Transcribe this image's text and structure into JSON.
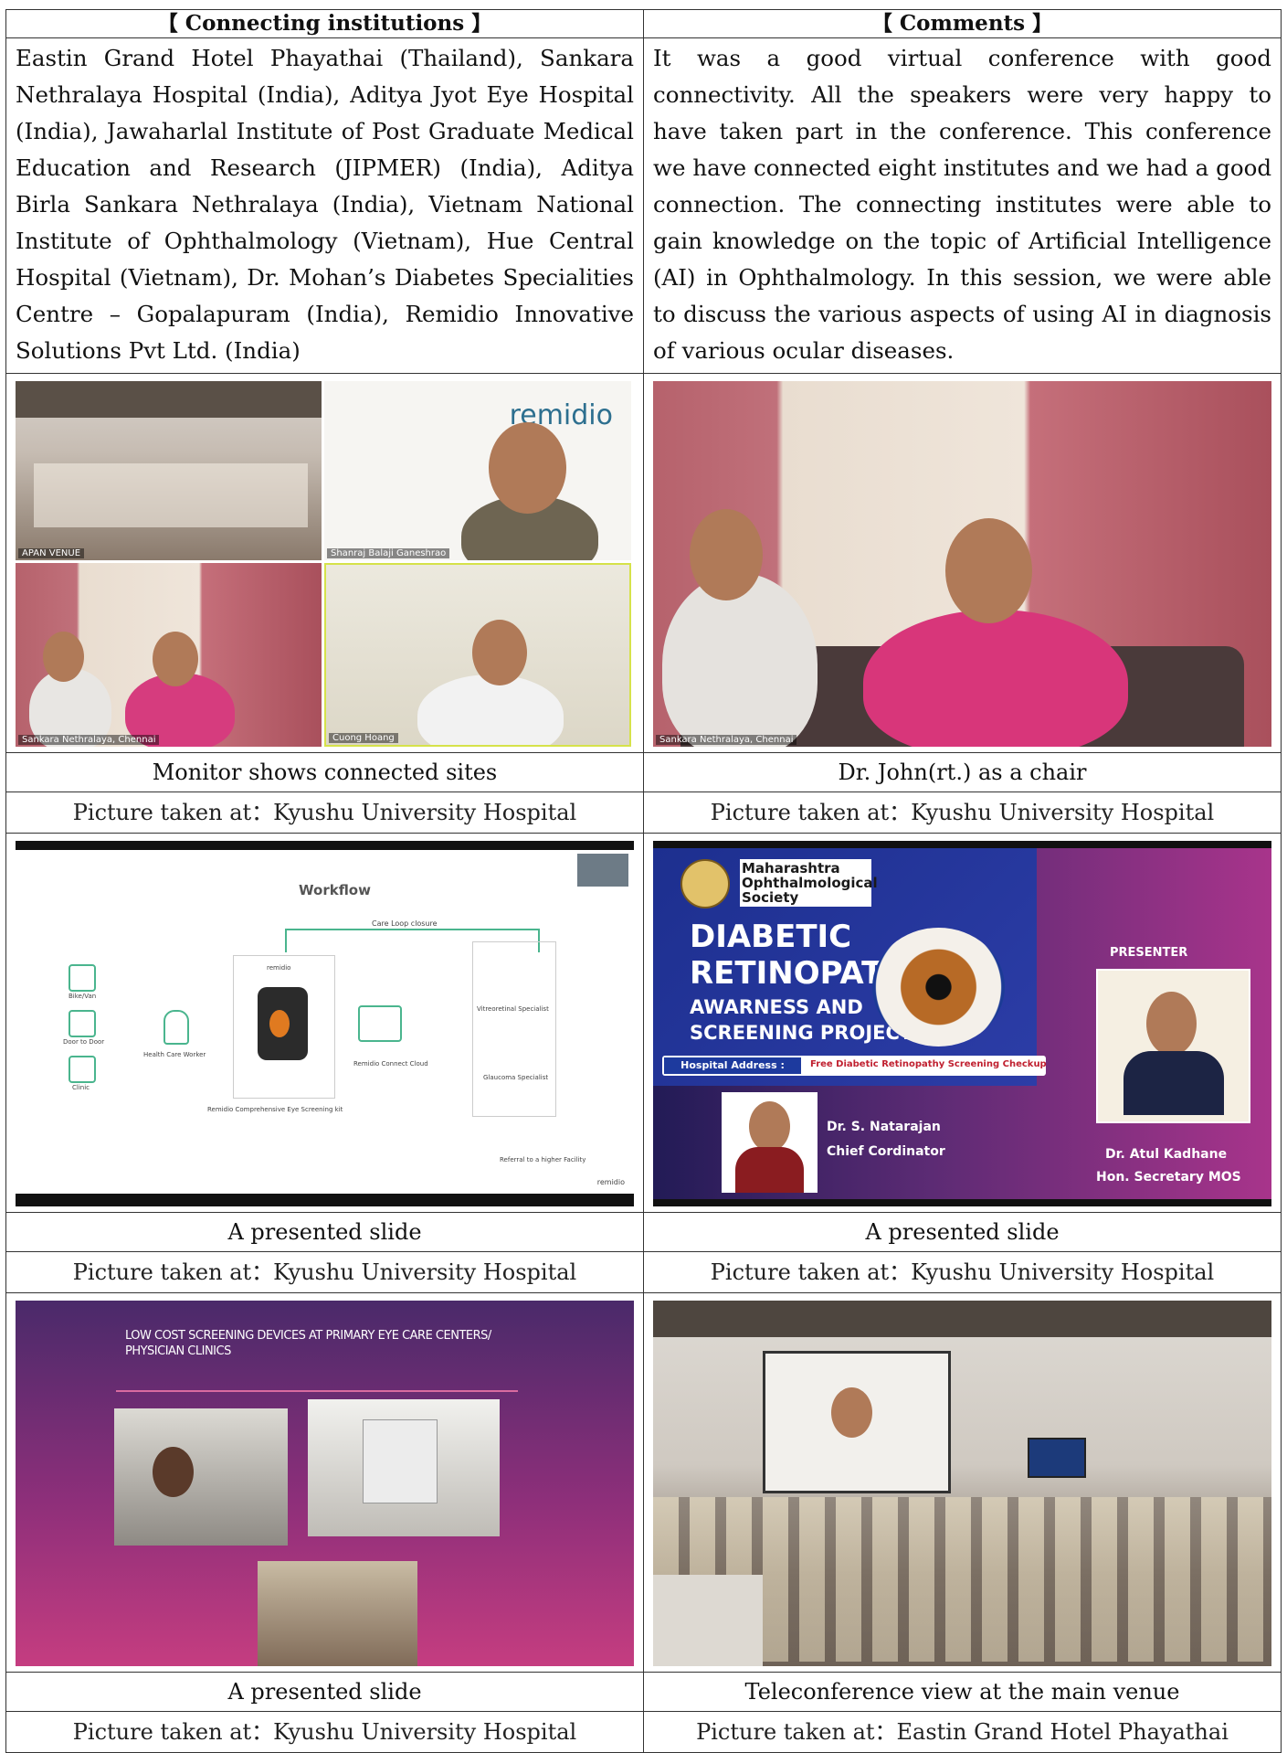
{
  "header": {
    "institutions_title": "【 Connecting institutions 】",
    "comments_title": "【 Comments 】"
  },
  "institutions_text": "Eastin Grand Hotel Phayathai (Thailand), Sankara Nethralaya Hospital (India), Aditya Jyot Eye Hospital (India), Jawaharlal Institute of Post Graduate Medical Education and Research (JIPMER) (India), Aditya Birla Sankara Nethralaya (India), Vietnam National Institute of Ophthalmology (Vietnam), Hue Central Hospital (Vietnam), Dr. Mohan’s Diabetes Specialities Centre – Gopalapuram (India), Remidio Innovative Solutions Pvt Ltd. (India)",
  "comments_text": "It was a good virtual conference with good connectivity. All the speakers were very happy to have taken part in the conference. This conference we have connected eight institutes and we had a good connection. The connecting institutes were able to gain knowledge on the topic of Artificial Intelligence (AI) in Ophthalmology. In this session, we were able to discuss the various aspects of using AI in diagnosis of various ocular diseases.",
  "photos": [
    {
      "caption": "Monitor shows connected sites",
      "taken_at": "Picture taken at：Kyushu University Hospital",
      "tiles": [
        "APAN VENUE",
        "Shanraj Balaji Ganeshrao",
        "Sankara Nethralaya, Chennai",
        "Cuong Hoang"
      ],
      "logo": "remidio"
    },
    {
      "caption": "Dr. John(rt.) as a chair",
      "taken_at": "Picture taken at：Kyushu University Hospital",
      "tile_label": "Sankara Nethralaya, Chennai"
    },
    {
      "caption": "A presented slide",
      "taken_at": "Picture taken at：Kyushu University Hospital",
      "slide_title": "Workflow",
      "slide_labels": [
        "Care Loop closure",
        "remidio",
        "Bike/Van",
        "Door to Door",
        "Clinic",
        "Health Care Worker",
        "Remidio Comprehensive Eye Screening kit",
        "Remidio Connect Cloud",
        "Vitreoretinal Specialist",
        "Glaucoma Specialist",
        "Referral to a higher Facility",
        "remidio"
      ]
    },
    {
      "caption": "A presented slide",
      "taken_at": "Picture taken at：Kyushu University Hospital",
      "society": "Maharashtra Ophthalmological Society",
      "title_lines": [
        "DIABETIC",
        "RETINOPATHY",
        "AWARNESS AND",
        "SCREENING PROJECT"
      ],
      "address_label": "Hospital Address :",
      "checkup": "Free Diabetic Retinopathy Screening Checkup",
      "presenter_label": "PRESENTER",
      "coordinator_name": "Dr. S. Natarajan",
      "coordinator_role": "Chief Cordinator",
      "presenter_name": "Dr. Atul Kadhane",
      "presenter_role": "Hon. Secretary MOS"
    },
    {
      "caption": "A presented slide",
      "taken_at": "Picture taken at：Kyushu University Hospital",
      "slide_title": "LOW COST SCREENING DEVICES AT PRIMARY EYE CARE CENTERS/ PHYSICIAN CLINICS"
    },
    {
      "caption": "Teleconference view at the main venue",
      "taken_at": "Picture taken at：Eastin Grand Hotel Phayathai"
    }
  ]
}
